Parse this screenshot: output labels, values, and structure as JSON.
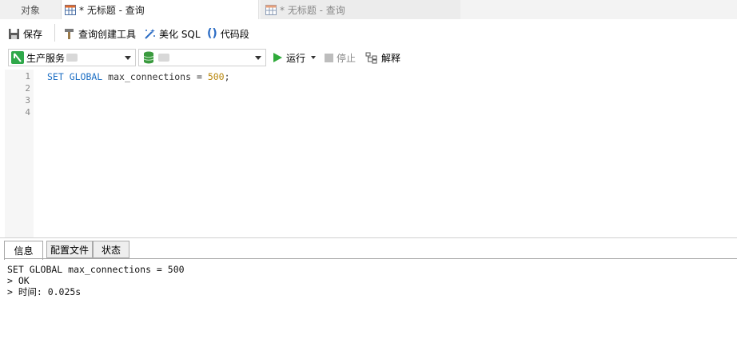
{
  "tabs": {
    "objects_label": "对象",
    "active_label": "* 无标题 - 查询",
    "inactive_label": "* 无标题 - 查询"
  },
  "toolbar": {
    "save_label": "保存",
    "query_builder_label": "查询创建工具",
    "beautify_label": "美化 SQL",
    "snippet_label": "代码段"
  },
  "connection": {
    "name": "生产服务",
    "database": ""
  },
  "actions": {
    "run_label": "运行",
    "stop_label": "停止",
    "explain_label": "解释"
  },
  "editor": {
    "line_numbers": [
      "1",
      "2",
      "3",
      "4"
    ],
    "code_keyword": "SET GLOBAL",
    "code_rest": " max_connections = ",
    "code_number": "500",
    "code_end": ";"
  },
  "result_tabs": {
    "info_label": "信息",
    "profile_label": "配置文件",
    "status_label": "状态"
  },
  "output": {
    "lines": [
      "SET GLOBAL max_connections = 500",
      "> OK",
      "> 时间: 0.025s"
    ]
  },
  "colors": {
    "keyword": "#1d6fc4",
    "number": "#b8860b",
    "run_green": "#2faa3a",
    "db_green": "#3a9a3e"
  }
}
